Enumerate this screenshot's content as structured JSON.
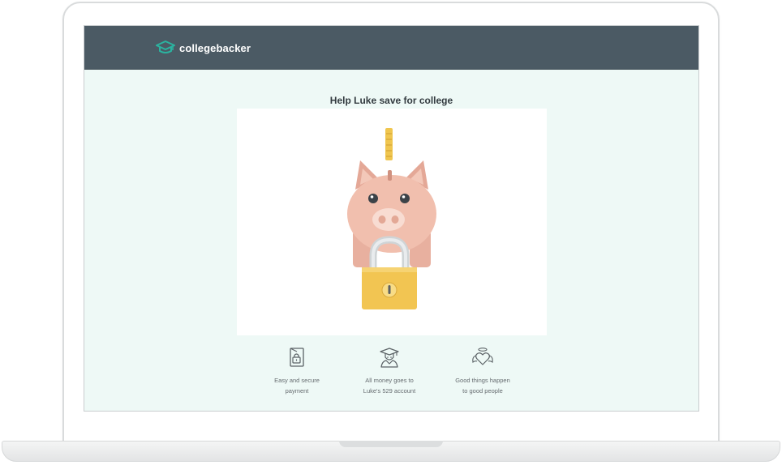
{
  "app": {
    "brand_name": "collegebacker",
    "brand_color": "#2bb3a0",
    "header_color": "#4b5a64",
    "background_color": "#eef9f6"
  },
  "main": {
    "title": "Help Luke save for college",
    "hero_icons": [
      "coin-icon",
      "piggy-bank-icon",
      "padlock-icon"
    ]
  },
  "features": [
    {
      "icon": "secure-lock-icon",
      "line1": "Easy and secure",
      "line2": "payment"
    },
    {
      "icon": "graduate-icon",
      "line1": "All money goes to",
      "line2": "Luke's 529 account"
    },
    {
      "icon": "angel-heart-icon",
      "line1": "Good things happen",
      "line2": "to good people"
    }
  ]
}
